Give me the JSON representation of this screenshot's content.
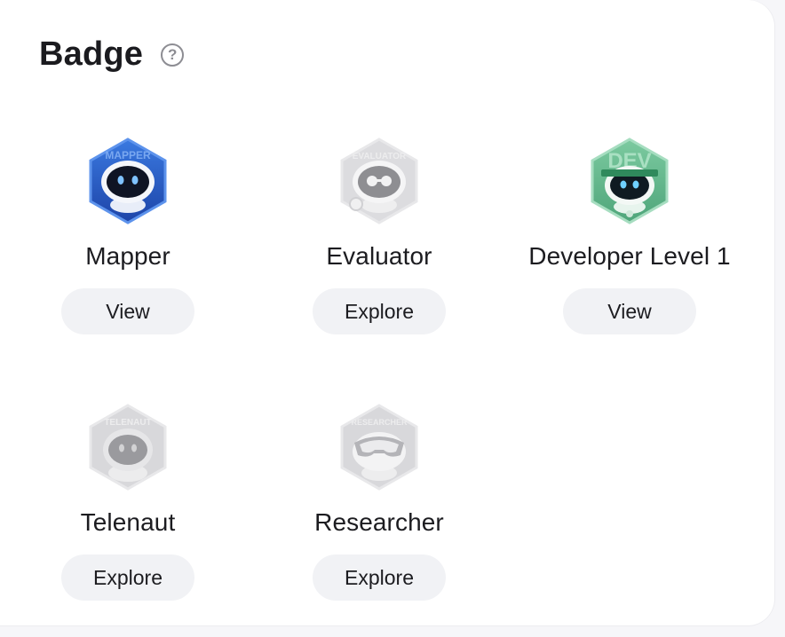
{
  "header": {
    "title": "Badge",
    "help_icon": "?"
  },
  "badges": [
    {
      "name": "Mapper",
      "button": "View",
      "icon": "mapper-badge-icon",
      "status": "earned",
      "ring_text": "MAPPER"
    },
    {
      "name": "Evaluator",
      "button": "Explore",
      "icon": "evaluator-badge-icon",
      "status": "locked",
      "ring_text": "EVALUATOR"
    },
    {
      "name": "Developer Level 1",
      "button": "View",
      "icon": "developer-badge-icon",
      "status": "earned",
      "ring_text": "DEV"
    },
    {
      "name": "Telenaut",
      "button": "Explore",
      "icon": "telenaut-badge-icon",
      "status": "locked",
      "ring_text": "TELENAUT"
    },
    {
      "name": "Researcher",
      "button": "Explore",
      "icon": "researcher-badge-icon",
      "status": "locked",
      "ring_text": "RESEARCHER"
    }
  ],
  "colors": {
    "mapper": "#2f63c8",
    "developer": "#5fb88c",
    "locked": "#d6d6d9",
    "button_bg": "#f1f2f5"
  }
}
